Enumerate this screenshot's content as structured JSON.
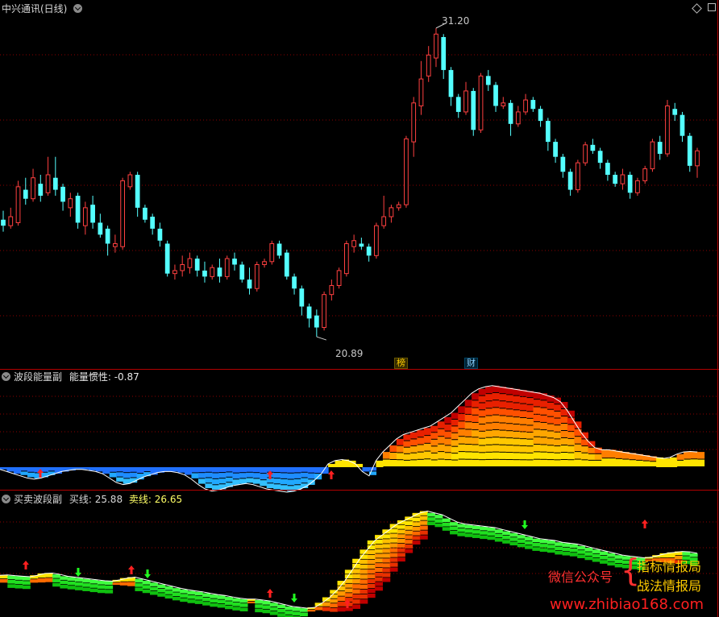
{
  "header": {
    "title": "中兴通讯(日线)",
    "high_label": "31.20",
    "low_label": "20.89",
    "tag_a": "榜",
    "tag_b": "财"
  },
  "panel2": {
    "title": "波段能量副",
    "metric_label": "能量惯性:",
    "metric_value": "-0.87"
  },
  "panel3": {
    "title": "买卖波段副",
    "buy_label": "买线:",
    "buy_value": "25.88",
    "sell_label": "卖线:",
    "sell_value": "26.65"
  },
  "watermark": {
    "wechat": "微信公众号",
    "line1": "指标情报局",
    "line2": "战法情报局",
    "url": "www.zhibiao168.com"
  },
  "colors": {
    "up": "#ff4040",
    "down": "#54ffff",
    "grid": "#8b0000",
    "border": "#b40000"
  },
  "chart_data": {
    "type": "candlestick",
    "y_high": 31.2,
    "y_low": 20.89,
    "candles": [
      {
        "o": 24.8,
        "c": 24.6,
        "h": 25.1,
        "l": 24.4
      },
      {
        "o": 24.6,
        "c": 24.9,
        "h": 25.2,
        "l": 24.5
      },
      {
        "o": 24.7,
        "c": 25.9,
        "h": 26.1,
        "l": 24.6
      },
      {
        "o": 25.8,
        "c": 25.5,
        "h": 26.2,
        "l": 25.3
      },
      {
        "o": 25.5,
        "c": 26.2,
        "h": 26.5,
        "l": 25.4
      },
      {
        "o": 26.0,
        "c": 25.6,
        "h": 26.3,
        "l": 25.4
      },
      {
        "o": 25.7,
        "c": 26.3,
        "h": 26.9,
        "l": 25.6
      },
      {
        "o": 26.2,
        "c": 25.8,
        "h": 26.9,
        "l": 25.6
      },
      {
        "o": 25.9,
        "c": 25.4,
        "h": 26.0,
        "l": 25.1
      },
      {
        "o": 25.2,
        "c": 25.5,
        "h": 25.7,
        "l": 24.9
      },
      {
        "o": 25.6,
        "c": 24.7,
        "h": 25.7,
        "l": 24.5
      },
      {
        "o": 24.6,
        "c": 25.2,
        "h": 25.4,
        "l": 24.3
      },
      {
        "o": 25.3,
        "c": 24.7,
        "h": 25.6,
        "l": 24.5
      },
      {
        "o": 24.7,
        "c": 24.3,
        "h": 25.0,
        "l": 24.2
      },
      {
        "o": 24.5,
        "c": 24.0,
        "h": 24.6,
        "l": 23.6
      },
      {
        "o": 23.9,
        "c": 24.0,
        "h": 24.3,
        "l": 23.7
      },
      {
        "o": 23.9,
        "c": 26.1,
        "h": 26.2,
        "l": 23.8
      },
      {
        "o": 25.9,
        "c": 26.3,
        "h": 26.4,
        "l": 25.8
      },
      {
        "o": 26.3,
        "c": 25.2,
        "h": 26.4,
        "l": 24.9
      },
      {
        "o": 25.2,
        "c": 24.8,
        "h": 25.3,
        "l": 24.7
      },
      {
        "o": 24.9,
        "c": 24.5,
        "h": 25.0,
        "l": 24.3
      },
      {
        "o": 24.5,
        "c": 24.1,
        "h": 24.7,
        "l": 23.9
      },
      {
        "o": 24.0,
        "c": 23.0,
        "h": 24.1,
        "l": 22.9
      },
      {
        "o": 23.0,
        "c": 23.1,
        "h": 23.3,
        "l": 22.8
      },
      {
        "o": 23.1,
        "c": 23.3,
        "h": 23.6,
        "l": 22.9
      },
      {
        "o": 23.2,
        "c": 23.5,
        "h": 23.7,
        "l": 23.0
      },
      {
        "o": 23.5,
        "c": 23.1,
        "h": 23.6,
        "l": 22.9
      },
      {
        "o": 23.1,
        "c": 22.9,
        "h": 23.4,
        "l": 22.7
      },
      {
        "o": 22.9,
        "c": 23.2,
        "h": 23.3,
        "l": 22.8
      },
      {
        "o": 23.2,
        "c": 22.9,
        "h": 23.5,
        "l": 22.7
      },
      {
        "o": 22.9,
        "c": 23.5,
        "h": 23.6,
        "l": 22.8
      },
      {
        "o": 23.5,
        "c": 23.3,
        "h": 23.7,
        "l": 23.1
      },
      {
        "o": 23.3,
        "c": 22.8,
        "h": 23.4,
        "l": 22.7
      },
      {
        "o": 22.8,
        "c": 22.5,
        "h": 23.2,
        "l": 22.3
      },
      {
        "o": 22.5,
        "c": 23.3,
        "h": 23.4,
        "l": 22.4
      },
      {
        "o": 23.3,
        "c": 23.4,
        "h": 23.5,
        "l": 23.2
      },
      {
        "o": 23.4,
        "c": 24.0,
        "h": 24.1,
        "l": 23.3
      },
      {
        "o": 24.0,
        "c": 23.6,
        "h": 24.1,
        "l": 23.5
      },
      {
        "o": 23.7,
        "c": 22.9,
        "h": 23.8,
        "l": 22.8
      },
      {
        "o": 22.9,
        "c": 22.5,
        "h": 23.0,
        "l": 22.3
      },
      {
        "o": 22.5,
        "c": 21.9,
        "h": 22.6,
        "l": 21.6
      },
      {
        "o": 21.9,
        "c": 21.5,
        "h": 22.0,
        "l": 21.2
      },
      {
        "o": 21.6,
        "c": 21.2,
        "h": 21.8,
        "l": 20.89
      },
      {
        "o": 21.2,
        "c": 22.3,
        "h": 22.4,
        "l": 21.1
      },
      {
        "o": 22.3,
        "c": 22.6,
        "h": 22.8,
        "l": 22.1
      },
      {
        "o": 22.6,
        "c": 23.1,
        "h": 23.2,
        "l": 22.5
      },
      {
        "o": 23.0,
        "c": 24.0,
        "h": 24.1,
        "l": 22.9
      },
      {
        "o": 23.9,
        "c": 24.1,
        "h": 24.3,
        "l": 23.7
      },
      {
        "o": 24.0,
        "c": 23.9,
        "h": 24.2,
        "l": 23.8
      },
      {
        "o": 23.9,
        "c": 23.6,
        "h": 24.0,
        "l": 23.4
      },
      {
        "o": 23.6,
        "c": 24.6,
        "h": 24.7,
        "l": 23.5
      },
      {
        "o": 24.6,
        "c": 24.9,
        "h": 25.6,
        "l": 24.5
      },
      {
        "o": 24.9,
        "c": 25.2,
        "h": 25.3,
        "l": 24.7
      },
      {
        "o": 25.2,
        "c": 25.3,
        "h": 25.4,
        "l": 25.1
      },
      {
        "o": 25.3,
        "c": 27.5,
        "h": 27.6,
        "l": 25.2
      },
      {
        "o": 27.4,
        "c": 28.7,
        "h": 28.9,
        "l": 26.9
      },
      {
        "o": 28.6,
        "c": 29.5,
        "h": 30.1,
        "l": 28.3
      },
      {
        "o": 29.6,
        "c": 30.3,
        "h": 30.6,
        "l": 29.4
      },
      {
        "o": 30.2,
        "c": 31.0,
        "h": 31.2,
        "l": 29.9
      },
      {
        "o": 30.9,
        "c": 29.8,
        "h": 31.0,
        "l": 29.5
      },
      {
        "o": 29.8,
        "c": 28.9,
        "h": 29.9,
        "l": 28.6
      },
      {
        "o": 28.9,
        "c": 28.4,
        "h": 29.0,
        "l": 28.2
      },
      {
        "o": 28.4,
        "c": 29.1,
        "h": 29.4,
        "l": 28.3
      },
      {
        "o": 29.1,
        "c": 27.8,
        "h": 29.2,
        "l": 27.6
      },
      {
        "o": 27.8,
        "c": 29.6,
        "h": 29.7,
        "l": 27.7
      },
      {
        "o": 29.6,
        "c": 29.3,
        "h": 29.8,
        "l": 29.1
      },
      {
        "o": 29.3,
        "c": 28.6,
        "h": 29.4,
        "l": 28.4
      },
      {
        "o": 28.6,
        "c": 28.7,
        "h": 28.9,
        "l": 28.5
      },
      {
        "o": 28.7,
        "c": 28.0,
        "h": 28.8,
        "l": 27.6
      },
      {
        "o": 28.0,
        "c": 28.4,
        "h": 28.6,
        "l": 27.9
      },
      {
        "o": 28.4,
        "c": 28.8,
        "h": 29.0,
        "l": 28.3
      },
      {
        "o": 28.8,
        "c": 28.5,
        "h": 28.9,
        "l": 28.4
      },
      {
        "o": 28.5,
        "c": 28.1,
        "h": 28.6,
        "l": 27.9
      },
      {
        "o": 28.1,
        "c": 27.4,
        "h": 28.2,
        "l": 27.1
      },
      {
        "o": 27.4,
        "c": 26.9,
        "h": 27.5,
        "l": 26.7
      },
      {
        "o": 26.9,
        "c": 26.4,
        "h": 27.0,
        "l": 26.2
      },
      {
        "o": 26.4,
        "c": 25.8,
        "h": 26.5,
        "l": 25.6
      },
      {
        "o": 25.8,
        "c": 26.7,
        "h": 26.8,
        "l": 25.7
      },
      {
        "o": 26.7,
        "c": 27.3,
        "h": 27.4,
        "l": 26.6
      },
      {
        "o": 27.3,
        "c": 27.1,
        "h": 27.5,
        "l": 27.0
      },
      {
        "o": 27.1,
        "c": 26.7,
        "h": 27.2,
        "l": 26.5
      },
      {
        "o": 26.7,
        "c": 26.3,
        "h": 26.8,
        "l": 26.1
      },
      {
        "o": 26.3,
        "c": 26.0,
        "h": 26.4,
        "l": 25.9
      },
      {
        "o": 26.0,
        "c": 26.3,
        "h": 26.5,
        "l": 25.8
      },
      {
        "o": 26.3,
        "c": 25.7,
        "h": 26.4,
        "l": 25.5
      },
      {
        "o": 25.7,
        "c": 26.1,
        "h": 26.2,
        "l": 25.6
      },
      {
        "o": 26.1,
        "c": 26.5,
        "h": 26.6,
        "l": 26.0
      },
      {
        "o": 26.5,
        "c": 27.4,
        "h": 27.5,
        "l": 26.4
      },
      {
        "o": 27.4,
        "c": 27.0,
        "h": 27.6,
        "l": 26.8
      },
      {
        "o": 27.0,
        "c": 28.6,
        "h": 28.8,
        "l": 26.9
      },
      {
        "o": 28.5,
        "c": 28.3,
        "h": 28.7,
        "l": 28.1
      },
      {
        "o": 28.3,
        "c": 27.6,
        "h": 28.4,
        "l": 27.4
      },
      {
        "o": 27.6,
        "c": 26.6,
        "h": 27.7,
        "l": 26.4
      },
      {
        "o": 26.6,
        "c": 27.1,
        "h": 27.2,
        "l": 26.2
      }
    ],
    "energy": [
      -0.1,
      -0.2,
      -0.3,
      -0.4,
      -0.5,
      -0.55,
      -0.5,
      -0.4,
      -0.3,
      -0.2,
      -0.15,
      -0.1,
      -0.1,
      -0.15,
      -0.2,
      -0.3,
      -0.5,
      -0.7,
      -0.8,
      -0.75,
      -0.6,
      -0.45,
      -0.35,
      -0.25,
      -0.2,
      -0.2,
      -0.25,
      -0.35,
      -0.55,
      -0.8,
      -1.0,
      -1.1,
      -1.05,
      -0.95,
      -0.85,
      -0.8,
      -0.75,
      -0.8,
      -0.9,
      -1.0,
      -1.05,
      -1.1,
      -1.15,
      -1.1,
      -1.0,
      -0.85,
      -0.6,
      -0.3,
      0.15,
      0.3,
      0.35,
      0.3,
      0.15,
      -0.2,
      -0.4,
      0.3,
      0.7,
      1.0,
      1.3,
      1.5,
      1.6,
      1.7,
      1.8,
      1.9,
      2.1,
      2.3,
      2.5,
      2.8,
      3.1,
      3.4,
      3.6,
      3.7,
      3.75,
      3.7,
      3.65,
      3.6,
      3.55,
      3.5,
      3.45,
      3.4,
      3.3,
      3.2,
      3.0,
      2.6,
      2.1,
      1.6,
      1.2,
      0.9,
      0.8,
      0.8,
      0.75,
      0.7,
      0.65,
      0.6,
      0.55,
      0.5,
      0.45,
      0.4,
      0.45,
      0.6,
      0.7,
      0.72,
      0.7
    ],
    "bands": [
      25.6,
      25.62,
      25.58,
      25.55,
      25.52,
      25.6,
      25.7,
      25.72,
      25.65,
      25.55,
      25.5,
      25.45,
      25.4,
      25.35,
      25.3,
      25.28,
      25.35,
      25.45,
      25.5,
      25.4,
      25.3,
      25.2,
      25.1,
      25.0,
      24.9,
      24.82,
      24.75,
      24.7,
      24.62,
      24.55,
      24.5,
      24.42,
      24.35,
      24.3,
      24.3,
      24.25,
      24.2,
      24.1,
      24.0,
      23.9,
      23.85,
      23.8,
      23.85,
      24.1,
      24.4,
      24.8,
      25.3,
      25.9,
      26.5,
      27.0,
      27.5,
      27.8,
      28.1,
      28.4,
      28.6,
      28.8,
      29.0,
      29.1,
      29.0,
      28.9,
      28.7,
      28.5,
      28.4,
      28.35,
      28.3,
      28.25,
      28.2,
      28.1,
      28.0,
      27.9,
      27.8,
      27.7,
      27.6,
      27.55,
      27.5,
      27.4,
      27.35,
      27.3,
      27.2,
      27.1,
      27.0,
      26.9,
      26.8,
      26.7,
      26.65,
      26.6,
      26.55,
      26.6,
      26.7,
      26.8,
      26.85,
      26.9,
      26.88,
      26.8
    ]
  }
}
